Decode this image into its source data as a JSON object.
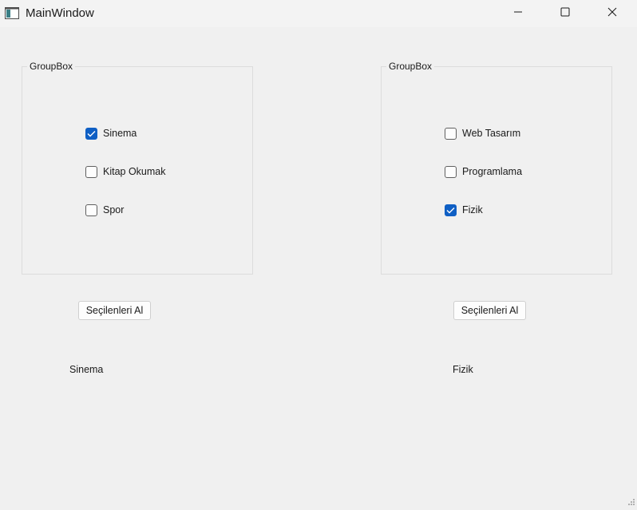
{
  "window": {
    "title": "MainWindow",
    "icons": {
      "app": "app-window-icon",
      "minimize": "minimize-icon",
      "maximize": "maximize-icon",
      "close": "close-icon"
    }
  },
  "left_group": {
    "title": "GroupBox",
    "checkboxes": [
      {
        "label": "Sinema",
        "checked": true
      },
      {
        "label": "Kitap Okumak",
        "checked": false
      },
      {
        "label": "Spor",
        "checked": false
      }
    ],
    "button_label": "Seçilenleri Al",
    "result_text": "Sinema"
  },
  "right_group": {
    "title": "GroupBox",
    "checkboxes": [
      {
        "label": "Web Tasarım",
        "checked": false
      },
      {
        "label": "Programlama",
        "checked": false
      },
      {
        "label": "Fizik",
        "checked": true
      }
    ],
    "button_label": "Seçilenleri Al",
    "result_text": "Fizik"
  },
  "colors": {
    "accent": "#0f5fc4",
    "background": "#f0f0f0"
  }
}
